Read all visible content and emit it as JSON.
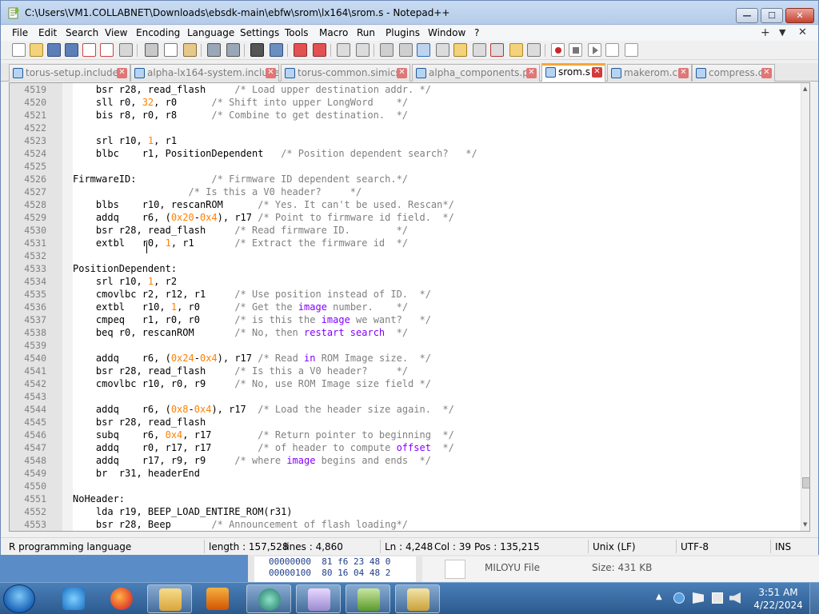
{
  "window": {
    "title": "C:\\Users\\VM1.COLLABNET\\Downloads\\ebsdk-main\\ebfw\\srom\\lx164\\srom.s - Notepad++",
    "min_symbol": "—",
    "max_symbol": "☐",
    "close_symbol": "✕"
  },
  "menu": {
    "items": [
      "File",
      "Edit",
      "Search",
      "View",
      "Encoding",
      "Language",
      "Settings",
      "Tools",
      "Macro",
      "Run",
      "Plugins",
      "Window",
      "?"
    ],
    "plus": "+",
    "down": "▼",
    "close": "✕"
  },
  "tabs": [
    {
      "label": "torus-setup.include",
      "active": false
    },
    {
      "label": "alpha-lx164-system.include",
      "active": false
    },
    {
      "label": "torus-common.simics",
      "active": false
    },
    {
      "label": "alpha_components.py",
      "active": false
    },
    {
      "label": "srom.s",
      "active": true
    },
    {
      "label": "makerom.c",
      "active": false
    },
    {
      "label": "compress.c",
      "active": false
    }
  ],
  "tab_close": "✕",
  "code": {
    "lines": [
      {
        "n": "4519",
        "t": "    bsr r28, read_flash     /* Load upper destination addr. */"
      },
      {
        "n": "4520",
        "t": "    sll r0, 32, r0      /* Shift into upper LongWord    */"
      },
      {
        "n": "4521",
        "t": "    bis r8, r0, r8      /* Combine to get destination.  */"
      },
      {
        "n": "4522",
        "t": ""
      },
      {
        "n": "4523",
        "t": "    srl r10, 1, r1"
      },
      {
        "n": "4524",
        "t": "    blbc    r1, PositionDependent   /* Position dependent search?   */"
      },
      {
        "n": "4525",
        "t": ""
      },
      {
        "n": "4526",
        "t": "FirmwareID:             /* Firmware ID dependent search.*/"
      },
      {
        "n": "4527",
        "t": "                    /* Is this a V0 header?     */"
      },
      {
        "n": "4528",
        "t": "    blbs    r10, rescanROM      /* Yes. It can't be used. Rescan*/"
      },
      {
        "n": "4529",
        "t": "    addq    r6, (0x20-0x4), r17 /* Point to firmware id field.  */"
      },
      {
        "n": "4530",
        "t": "    bsr r28, read_flash     /* Read firmware ID.        */"
      },
      {
        "n": "4531",
        "t": "    extbl   r0, 1, r1       /* Extract the firmware id  */"
      },
      {
        "n": "4532",
        "t": ""
      },
      {
        "n": "4533",
        "t": "PositionDependent:"
      },
      {
        "n": "4534",
        "t": "    srl r10, 1, r2"
      },
      {
        "n": "4535",
        "t": "    cmovlbc r2, r12, r1     /* Use position instead of ID.  */"
      },
      {
        "n": "4536",
        "t": "    extbl   r10, 1, r0      /* Get the image number.    */"
      },
      {
        "n": "4537",
        "t": "    cmpeq   r1, r0, r0      /* is this the image we want?   */"
      },
      {
        "n": "4538",
        "t": "    beq r0, rescanROM       /* No, then restart search  */"
      },
      {
        "n": "4539",
        "t": ""
      },
      {
        "n": "4540",
        "t": "    addq    r6, (0x24-0x4), r17 /* Read in ROM Image size.  */"
      },
      {
        "n": "4541",
        "t": "    bsr r28, read_flash     /* Is this a V0 header?     */"
      },
      {
        "n": "4542",
        "t": "    cmovlbc r10, r0, r9     /* No, use ROM Image size field */"
      },
      {
        "n": "4543",
        "t": ""
      },
      {
        "n": "4544",
        "t": "    addq    r6, (0x8-0x4), r17  /* Load the header size again.  */"
      },
      {
        "n": "4545",
        "t": "    bsr r28, read_flash"
      },
      {
        "n": "4546",
        "t": "    subq    r6, 0x4, r17        /* Return pointer to beginning  */"
      },
      {
        "n": "4547",
        "t": "    addq    r0, r17, r17        /* of header to compute offset  */"
      },
      {
        "n": "4548",
        "t": "    addq    r17, r9, r9     /* where image begins and ends  */"
      },
      {
        "n": "4549",
        "t": "    br  r31, headerEnd"
      },
      {
        "n": "4550",
        "t": ""
      },
      {
        "n": "4551",
        "t": "NoHeader:"
      },
      {
        "n": "4552",
        "t": "    lda r19, BEEP_LOAD_ENTIRE_ROM(r31)"
      },
      {
        "n": "4553",
        "t": "    bsr r28, Beep       /* Announcement of flash loading*/"
      }
    ]
  },
  "status": {
    "language": "R programming language",
    "length": "length : 157,528",
    "lines": "lines : 4,860",
    "ln": "Ln : 4,248",
    "col": "Col : 39",
    "pos": "Pos : 135,215",
    "eol": "Unix (LF)",
    "encoding": "UTF-8",
    "mode": "INS"
  },
  "background_window": {
    "hex_lines": [
      "00000000  81 f6 23 48 0",
      "00000100  80 16 04 48 2"
    ],
    "name": "MILOYU File",
    "size": "Size: 431 KB"
  },
  "taskbar": {
    "time": "3:51 AM",
    "date": "4/22/2024",
    "tray_arrow": "▲"
  },
  "colors": {
    "comment": "#808080",
    "number": "#ff8000",
    "keyword": "#8000ff",
    "active_tab_accent": "#f7a43a"
  }
}
